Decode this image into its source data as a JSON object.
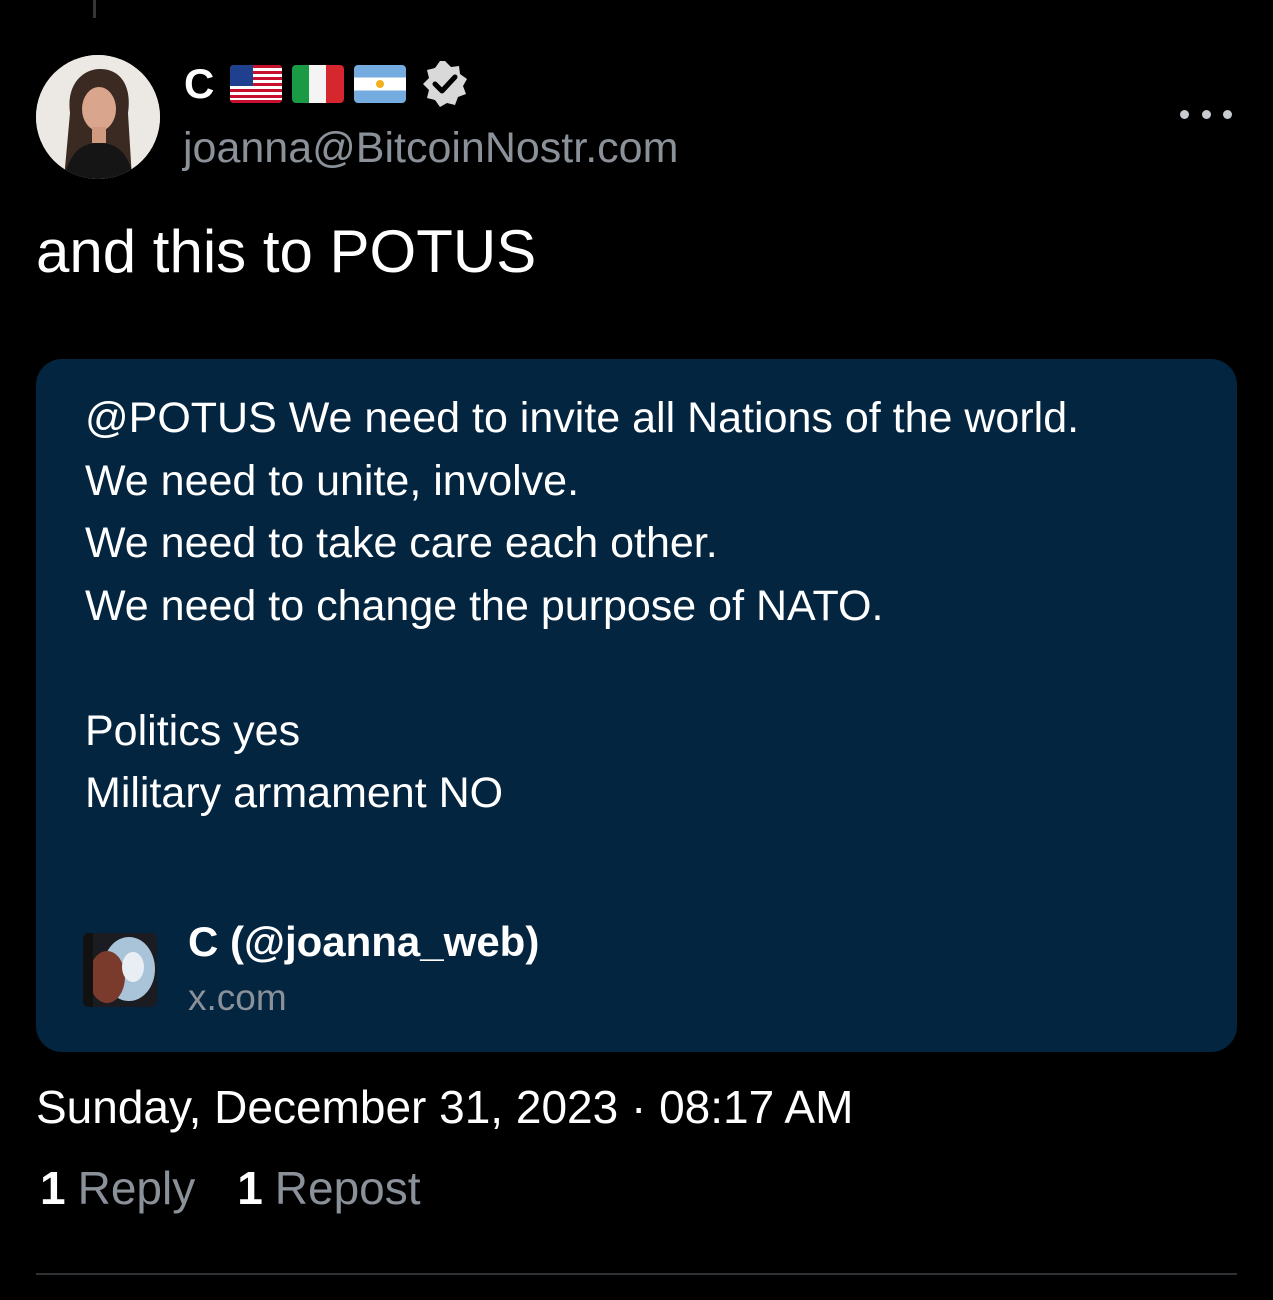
{
  "author": {
    "display_name": "C",
    "flags": [
      "us-flag-icon",
      "italy-flag-icon",
      "argentina-flag-icon"
    ],
    "badge": "verified-badge-icon",
    "handle": "joanna@BitcoinNostr.com"
  },
  "post": {
    "text": "and this to POTUS"
  },
  "embed": {
    "text": "@POTUS We need to invite all Nations of the world.\nWe need to unite, involve.\nWe need to take care each other.\nWe need to change the purpose of NATO.\n\nPolitics yes\nMilitary armament NO",
    "source_name": "C (@joanna_web)",
    "source_domain": "x.com"
  },
  "timestamp": "Sunday, December 31, 2023 · 08:17 AM",
  "stats": {
    "replies_count": "1",
    "replies_label": "Reply",
    "reposts_count": "1",
    "reposts_label": "Repost"
  },
  "colors": {
    "background": "#000000",
    "card": "#042540",
    "secondary_text": "#8b9199"
  }
}
